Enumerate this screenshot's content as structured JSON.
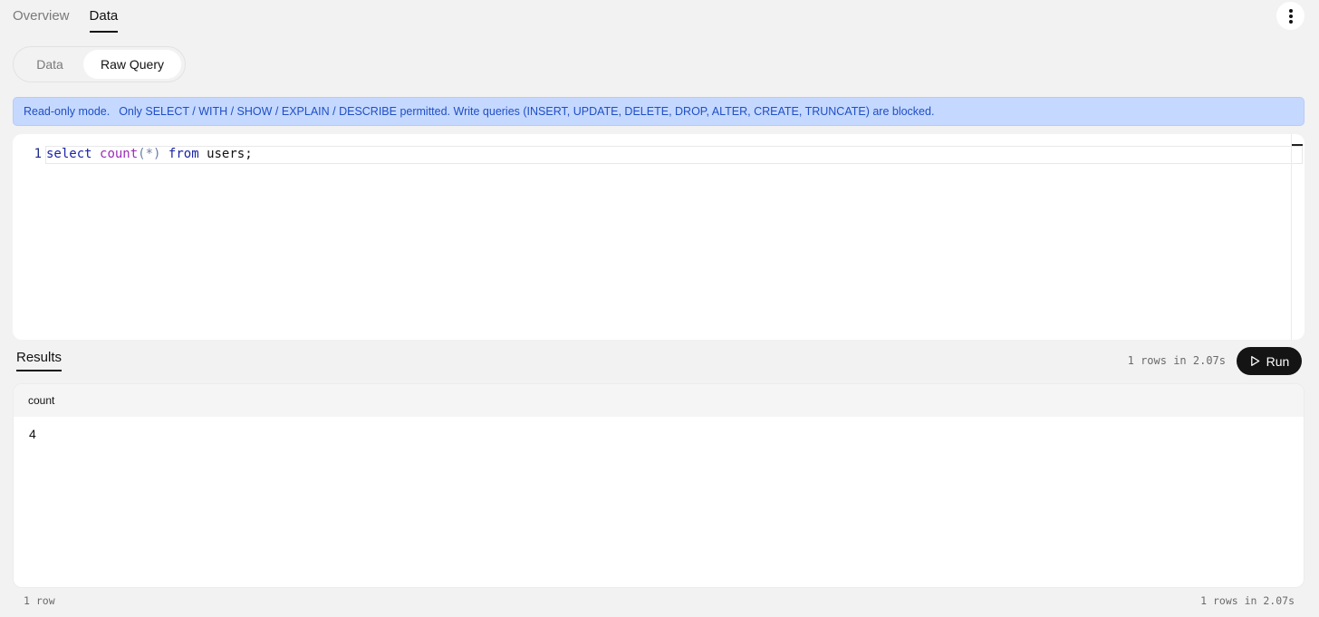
{
  "top_tabs": [
    {
      "label": "Overview",
      "active": false
    },
    {
      "label": "Data",
      "active": true
    }
  ],
  "more_menu_icon": "vertical-ellipsis-icon",
  "mode_toggle": {
    "options": [
      {
        "label": "Data",
        "active": false
      },
      {
        "label": "Raw Query",
        "active": true
      }
    ]
  },
  "banner": {
    "lead": "Read-only mode.",
    "text": "Only SELECT / WITH / SHOW / EXPLAIN / DESCRIBE permitted. Write queries (INSERT, UPDATE, DELETE, DROP, ALTER, CREATE, TRUNCATE) are blocked."
  },
  "editor": {
    "line_number": "1",
    "tokens": {
      "kw1": "select",
      "fn": "count",
      "op": "(*)",
      "kw2": "from",
      "rest": "users;"
    }
  },
  "results": {
    "tab_label": "Results",
    "status": "1 rows in 2.07s",
    "run_label": "Run",
    "run_icon": "play-icon",
    "columns": [
      "count"
    ],
    "rows": [
      [
        "4"
      ]
    ],
    "footer_left": "1 row",
    "footer_right": "1 rows in 2.07s"
  },
  "colors": {
    "background": "#f2f2f2",
    "banner_bg": "#c5d8ff",
    "banner_text": "#1e4fc4",
    "keyword": "#1a24a6",
    "function": "#9c2bb5",
    "run_button": "#141414"
  }
}
